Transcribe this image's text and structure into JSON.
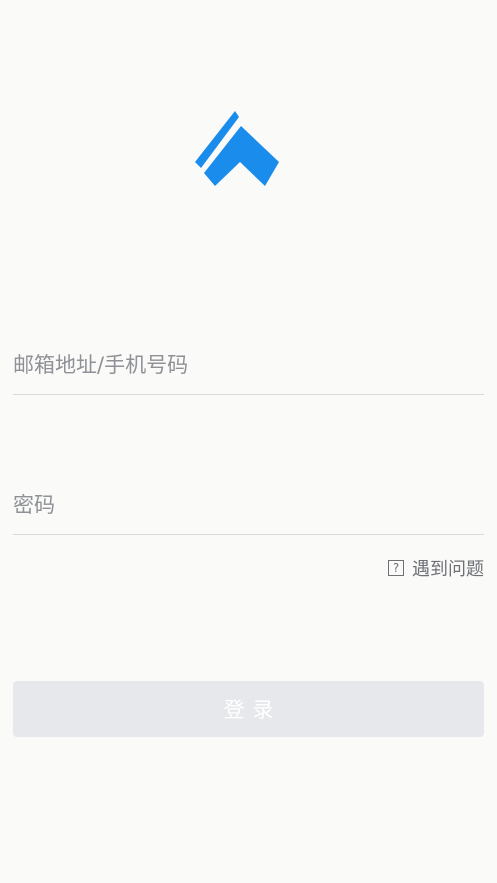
{
  "colors": {
    "brand": "#1A8CEC",
    "background": "#FAFAF8",
    "divider": "#D9DADC",
    "placeholder": "#8F9196",
    "button_bg": "#E6E8EB",
    "button_text": "#FFFFFF"
  },
  "logo": {
    "icon": "brand-logo-icon"
  },
  "form": {
    "account_placeholder": "邮箱地址/手机号码",
    "account_value": "",
    "password_placeholder": "密码",
    "password_value": ""
  },
  "help": {
    "icon": "question-mark-icon",
    "icon_glyph": "?",
    "label": "遇到问题"
  },
  "login_button": {
    "label": "登录"
  }
}
